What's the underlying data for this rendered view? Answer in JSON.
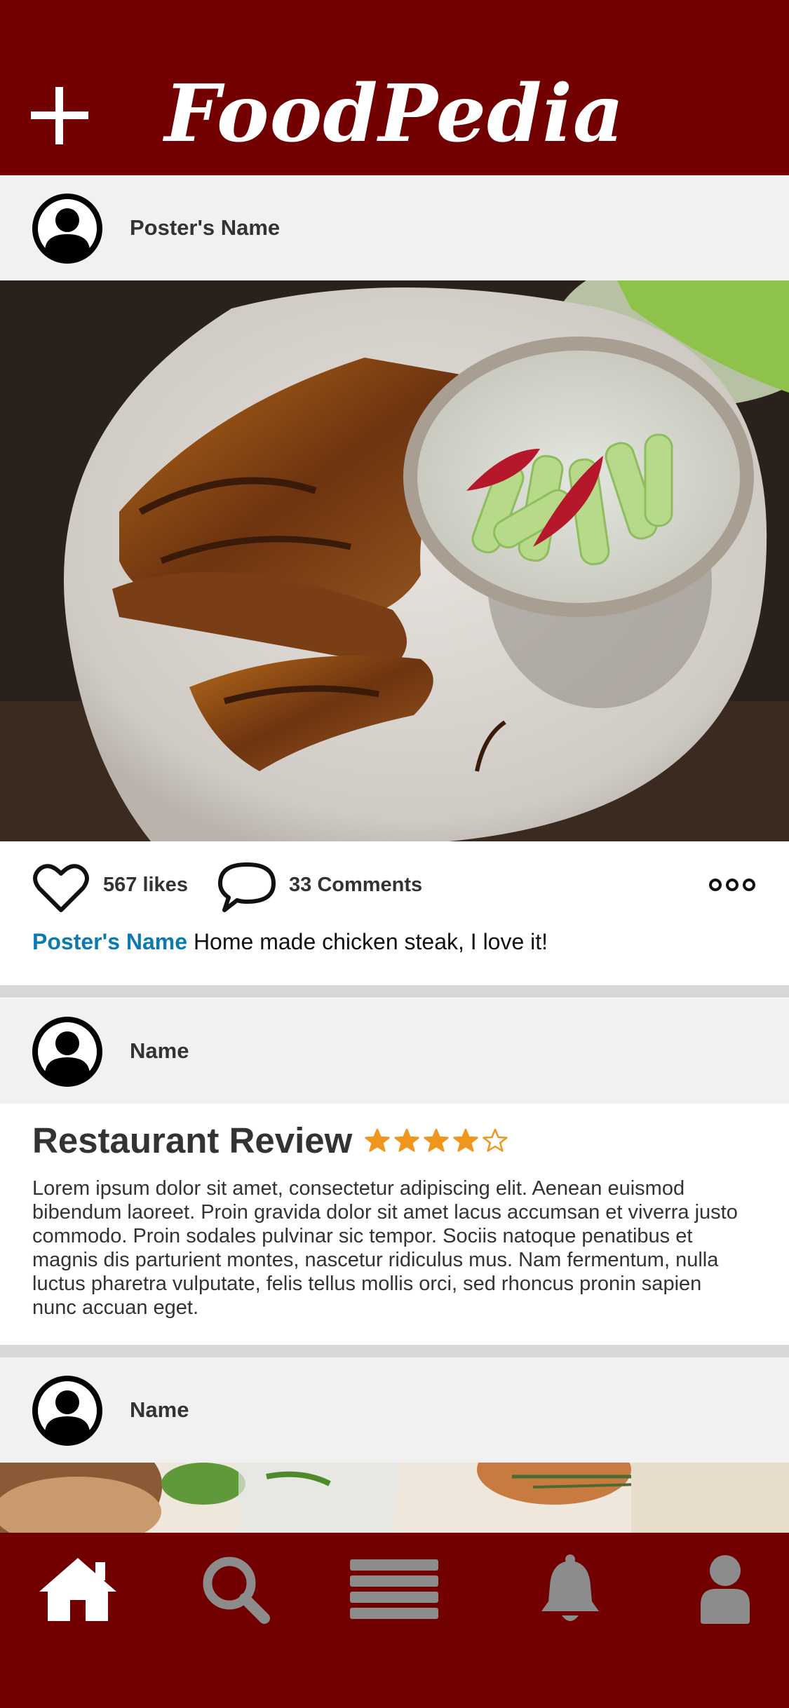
{
  "app": {
    "title": "FoodPedia"
  },
  "icons": {
    "add": "plus-icon",
    "avatar": "user-avatar-icon",
    "like": "heart-outline-icon",
    "comment": "speech-bubble-icon",
    "more": "ellipsis-icon",
    "star_full": "star-filled-icon",
    "star_empty": "star-outline-icon",
    "home": "home-icon",
    "search": "search-icon",
    "menu": "menu-icon",
    "notifications": "bell-icon",
    "profile": "person-icon"
  },
  "colors": {
    "brand": "#730000",
    "link": "#0b7ab2",
    "star": "#f0961e",
    "nav_active": "#ffffff",
    "nav_inactive": "#8c8c8c"
  },
  "feed": {
    "post1": {
      "poster": "Poster's Name",
      "likes": "567 likes",
      "comments": "33 Comments",
      "caption_user": "Poster's Name",
      "caption_text": " Home made chicken steak, I love it!"
    },
    "review": {
      "poster": "Name",
      "title": "Restaurant Review",
      "rating": 4,
      "rating_max": 5,
      "body": "Lorem ipsum dolor sit amet, consectetur adipiscing elit. Aenean euismod bibendum laoreet. Proin gravida dolor sit amet lacus accumsan et viverra justo commodo. Proin sodales pulvinar sic tempor. Sociis natoque penatibus et magnis dis parturient montes, nascetur ridiculus mus. Nam fermentum, nulla luctus pharetra vulputate, felis tellus mollis orci, sed rhoncus pronin sapien nunc accuan eget."
    },
    "post3": {
      "poster": "Name"
    }
  },
  "bottom_nav": {
    "active": "home"
  }
}
